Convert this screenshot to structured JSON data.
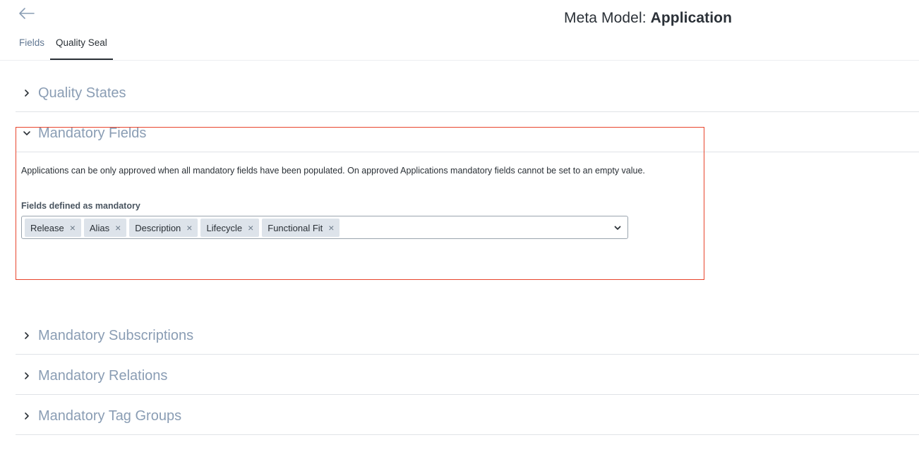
{
  "header": {
    "title_prefix": "Meta Model: ",
    "title_bold": "Application",
    "back_icon": "arrow-left-icon"
  },
  "tabs": [
    {
      "label": "Fields",
      "active": false
    },
    {
      "label": "Quality Seal",
      "active": true
    }
  ],
  "sections": {
    "quality_states": {
      "title": "Quality States",
      "expanded": false
    },
    "mandatory_fields": {
      "title": "Mandatory Fields",
      "expanded": true,
      "description": "Applications can be only approved when all mandatory fields have been populated. On approved Applications mandatory fields cannot be set to an empty value.",
      "field_label": "Fields defined as mandatory",
      "selected_fields": [
        {
          "label": "Release",
          "remove": "×"
        },
        {
          "label": "Alias",
          "remove": "×"
        },
        {
          "label": "Description",
          "remove": "×"
        },
        {
          "label": "Lifecycle",
          "remove": "×"
        },
        {
          "label": "Functional Fit",
          "remove": "×"
        }
      ]
    },
    "mandatory_subscriptions": {
      "title": "Mandatory Subscriptions",
      "expanded": false
    },
    "mandatory_relations": {
      "title": "Mandatory Relations",
      "expanded": false
    },
    "mandatory_tag_groups": {
      "title": "Mandatory Tag Groups",
      "expanded": false
    }
  },
  "colors": {
    "highlight": "#e8452c",
    "section_title": "#8a9db4",
    "chip_bg": "#dde3ea",
    "inactive_tab": "#627893"
  }
}
